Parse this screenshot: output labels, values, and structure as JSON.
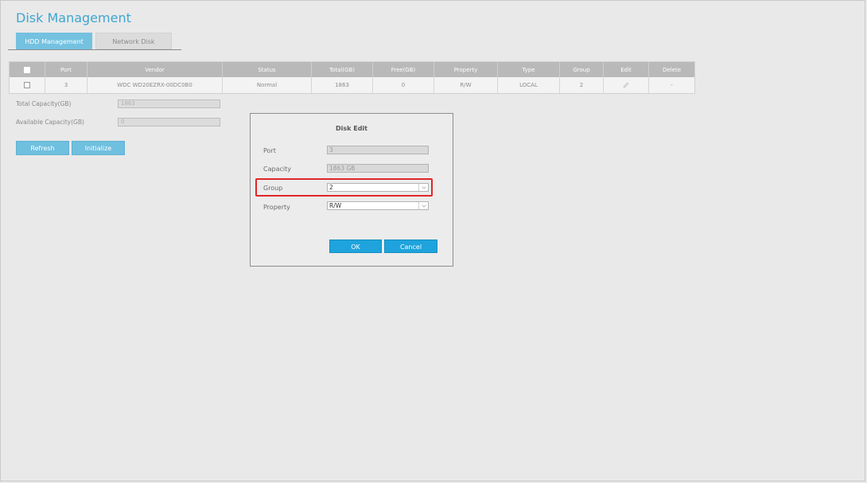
{
  "page": {
    "title": "Disk Management"
  },
  "tabs": [
    {
      "label": "HDD Management",
      "active": true
    },
    {
      "label": "Network Disk",
      "active": false
    }
  ],
  "table": {
    "headers": [
      "Port",
      "Vendor",
      "Status",
      "Total(GB)",
      "Free(GB)",
      "Property",
      "Type",
      "Group",
      "Edit",
      "Delete"
    ],
    "rows": [
      {
        "port": "3",
        "vendor": "WDC WD20EZRX-00DC0B0",
        "status": "Normal",
        "total": "1863",
        "free": "0",
        "property": "R/W",
        "type": "LOCAL",
        "group": "2",
        "edit_icon": "pencil-icon",
        "delete": "-"
      }
    ]
  },
  "capacity": {
    "total_label": "Total Capacity(GB)",
    "total_value": "1863",
    "available_label": "Available Capacity(GB)",
    "available_value": "0"
  },
  "actions": {
    "refresh": "Refresh",
    "initialize": "Initialize"
  },
  "dialog": {
    "title": "Disk Edit",
    "port_label": "Port",
    "port_value": "3",
    "capacity_label": "Capacity",
    "capacity_value": "1863 GB",
    "group_label": "Group",
    "group_value": "2",
    "property_label": "Property",
    "property_value": "R/W",
    "ok": "OK",
    "cancel": "Cancel"
  },
  "colors": {
    "accent": "#3ea6d2",
    "tab_active": "#74c1e0",
    "button_primary": "#1ea3dc",
    "highlight": "#e0262a"
  }
}
